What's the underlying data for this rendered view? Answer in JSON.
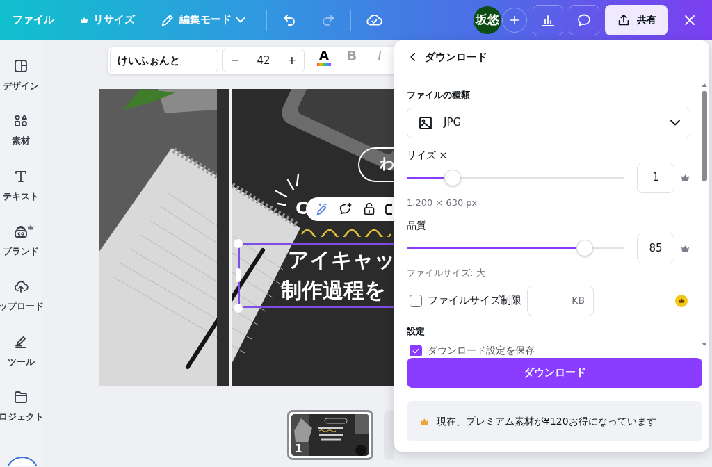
{
  "top_bar": {
    "menus": [
      {
        "kind": "menu",
        "label": "ファイル",
        "premium": false
      },
      {
        "kind": "menu",
        "label": "リサイズ",
        "premium": true
      },
      {
        "kind": "mode",
        "label": "編集モード",
        "premium": false
      }
    ],
    "history": [
      {
        "kind": "undo",
        "disabled": false
      },
      {
        "kind": "redo",
        "disabled": true
      }
    ],
    "avatar": {
      "initials": "坂悠"
    },
    "share_button": {
      "label": "共有"
    }
  },
  "sidebar": {
    "items": [
      {
        "label": "デザイン",
        "premium": false
      },
      {
        "label": "素材",
        "premium": false
      },
      {
        "label": "テキスト",
        "premium": false
      },
      {
        "label": "ブランド",
        "premium": true
      },
      {
        "label": "ップロード",
        "premium": false
      },
      {
        "label": "ツール",
        "premium": false
      },
      {
        "label": "ロジェクト",
        "premium": false
      }
    ]
  },
  "text_toolbar": {
    "font": "けいふぉんと",
    "decrease": "−",
    "size": "42",
    "increase": "+",
    "color_letter": "A",
    "bold": "B",
    "italic": "I"
  },
  "design": {
    "badge_text": "わ",
    "subtitle": "C",
    "title_lines": [
      "アイキャッ",
      "制作過程を"
    ],
    "selected": true
  },
  "pages": [
    {
      "number": "1",
      "selected": true
    }
  ],
  "download_panel": {
    "title": "ダウンロード",
    "file_type": {
      "label": "ファイルの種類",
      "value": "JPG"
    },
    "size": {
      "label": "サイズ ×",
      "value": "1",
      "level": 0.21,
      "premium": true
    },
    "dimensions": "1,200 × 630 px",
    "quality": {
      "label": "品質",
      "value": "85",
      "level": 0.82,
      "premium": true
    },
    "file_size": "ファイルサイズ: 大",
    "size_limit": {
      "label": "ファイルサイズ制限",
      "unit": "KB",
      "checked": false,
      "premium": true
    },
    "settings": {
      "heading": "設定",
      "options": [
        {
          "label": "ダウンロード設定を保存",
          "checked": true
        }
      ]
    },
    "download_button": "ダウンロード",
    "promo": "現在、プレミアム素材が¥120お得になっています"
  }
}
